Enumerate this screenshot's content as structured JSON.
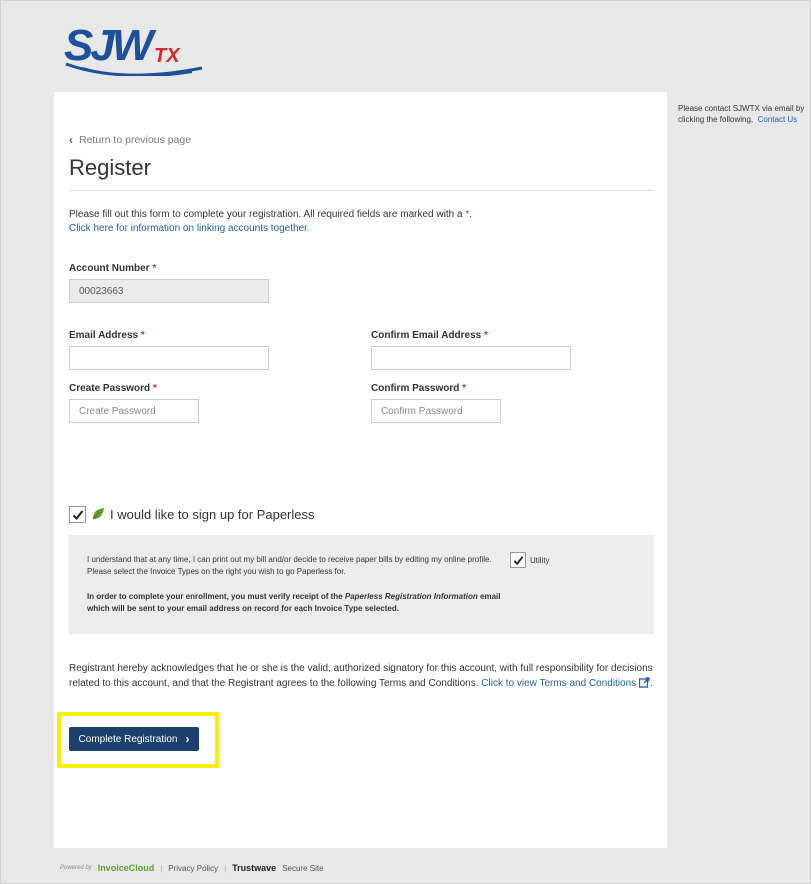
{
  "logo": {
    "text": "SJW",
    "sub": "TX"
  },
  "aside": {
    "text": "Please contact SJWTX via email by clicking the following,",
    "link": "Contact Us"
  },
  "back": {
    "label": "Return to previous page"
  },
  "page": {
    "title": "Register"
  },
  "intro": {
    "text": "Please fill out this form to complete your registration. All required fields are marked with a",
    "req_mark": "*",
    "end": ".",
    "link": "Click here for information on linking accounts together."
  },
  "form": {
    "required_mark": "*",
    "account": {
      "label": "Account Number",
      "value": "00023663"
    },
    "email": {
      "label": "Email Address",
      "value": ""
    },
    "confirm_email": {
      "label": "Confirm Email Address",
      "value": ""
    },
    "password": {
      "label": "Create Password",
      "placeholder": "Create Password"
    },
    "confirm_password": {
      "label": "Confirm Password",
      "placeholder": "Confirm Password"
    }
  },
  "paperless": {
    "label": "I would like to sign up for Paperless",
    "checked": true,
    "text1": "I understand that at any time, I can print out my bill and/or decide to receive paper bills by editing my online profile. Please select the Invoice Types on the right you wish to go Paperless for.",
    "text2_a": "In order to complete your enrollment, you must verify receipt of the",
    "text2_em": "Paperless Registration Information",
    "text2_b": "email which will be sent to your email address on record for each Invoice Type selected.",
    "utility_label": "Utility",
    "utility_checked": true
  },
  "ack": {
    "text": "Registrant hereby acknowledges that he or she is the valid, authorized signatory for this account, with full responsibility for decisions related to this account, and that the Registrant agrees to the following Terms and Conditions.",
    "link": "Click to view Terms and Conditions",
    "end": "."
  },
  "submit": {
    "label": "Complete Registration"
  },
  "footer": {
    "powered_by": "Powered by",
    "brand": "InvoiceCloud",
    "privacy": "Privacy Policy",
    "trustwave": "Trustwave",
    "secure": "Secure Site"
  },
  "colors": {
    "primary_button": "#1c3f6e",
    "link": "#1f5fa8",
    "required": "#c0392b",
    "highlight": "#f6ef0a",
    "leaf": "#5aa02c"
  }
}
